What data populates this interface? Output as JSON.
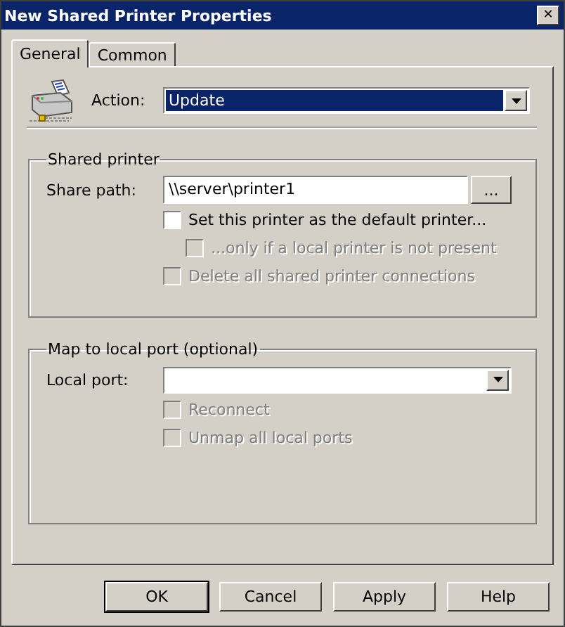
{
  "window": {
    "title": "New Shared Printer Properties",
    "close": "✕"
  },
  "tabs": [
    {
      "label": "General",
      "selected": true
    },
    {
      "label": "Common",
      "selected": false
    }
  ],
  "action": {
    "label": "Action:",
    "value": "Update",
    "focused": true
  },
  "shared_printer": {
    "title": "Shared printer",
    "share_path": {
      "label": "Share path:",
      "value": "\\\\server\\printer1",
      "browse": "..."
    },
    "checkboxes": [
      {
        "label": "Set this printer as the default printer...",
        "checked": false,
        "disabled": false,
        "children": [
          {
            "label": "...only if a local printer is not present",
            "checked": false,
            "disabled": true
          }
        ]
      },
      {
        "label": "Delete all shared printer connections",
        "checked": false,
        "disabled": true
      }
    ]
  },
  "local_port": {
    "title": "Map to local port (optional)",
    "port": {
      "label": "Local port:"
    },
    "checkboxes": [
      {
        "label": "Reconnect",
        "checked": false,
        "disabled": true
      },
      {
        "label": "Unmap all local ports",
        "checked": false,
        "disabled": true
      }
    ]
  },
  "buttons": [
    {
      "label": "OK",
      "default": true
    },
    {
      "label": "Cancel",
      "default": false
    },
    {
      "label": "Apply",
      "default": false
    },
    {
      "label": "Help",
      "default": false
    }
  ]
}
